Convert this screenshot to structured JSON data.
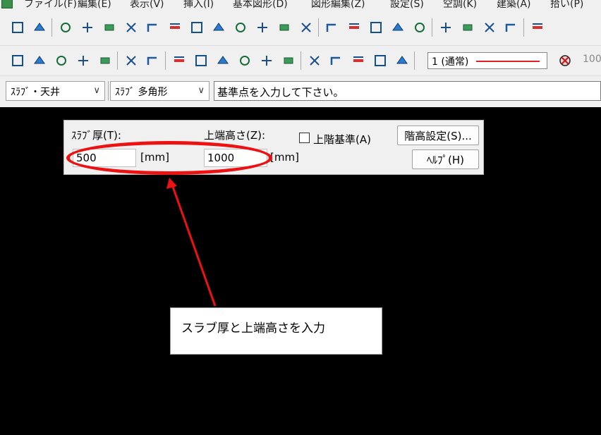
{
  "menubar": {
    "items": [
      "ファイル(F)",
      "編集(E)",
      "表示(V)",
      "挿入(I)",
      "基本図形(D)",
      "図形編集(Z)",
      "設定(S)",
      "空調(K)",
      "建築(A)",
      "拾い(P)"
    ]
  },
  "toolbar": {
    "line_setting": "1 (通常)",
    "zoom_text": "100",
    "icons_row1": [
      "wall-tool-icon",
      "duct-tool-icon",
      "fitting-icon",
      "branch-icon",
      "frame-icon",
      "joint-icon",
      "elbow-icon",
      "offset-icon",
      "reducer-icon",
      "level-icon",
      "fl-icon",
      "damper-icon",
      "dimension-icon",
      "hatch-icon",
      "arrow-dim-icon",
      "flip-icon",
      "cross-dim-icon",
      "stack-icon",
      "list-icon",
      "route-icon",
      "convert-icon",
      "symmetry-icon",
      "compass-icon",
      "tag-icon"
    ],
    "icons_row2": [
      "new-file-icon",
      "open-folder-icon",
      "save-icon",
      "print-preview-icon",
      "print-icon",
      "undo-icon",
      "redo-icon",
      "property-icon",
      "info-icon",
      "info-line-icon",
      "brush-icon",
      "sheet-icon",
      "fit-window-icon",
      "split-view-icon",
      "snap-icon",
      "select-icon",
      "layer-icon",
      "linetype-icon",
      "no-entry-icon"
    ]
  },
  "command": {
    "element_type": "ｽﾗﾌﾞ・天井",
    "shape_type": "ｽﾗﾌﾞ 多角形",
    "hint": "基準点を入力して下さい。"
  },
  "panel": {
    "slab_thickness_label": "ｽﾗﾌﾞ厚(T):",
    "slab_thickness_value": "500",
    "slab_unit": "[mm]",
    "top_height_label": "上端高さ(Z):",
    "top_height_value": "1000",
    "top_unit": "[mm]",
    "upper_floor_label": "上階基準(A)",
    "upper_floor_checked": false,
    "floor_height_button": "階高設定(S)...",
    "help_button": "ﾍﾙﾌﾟ(H)"
  },
  "annotation": {
    "callout_text": "スラブ厚と上端高さを入力",
    "color": "#ee1111"
  }
}
